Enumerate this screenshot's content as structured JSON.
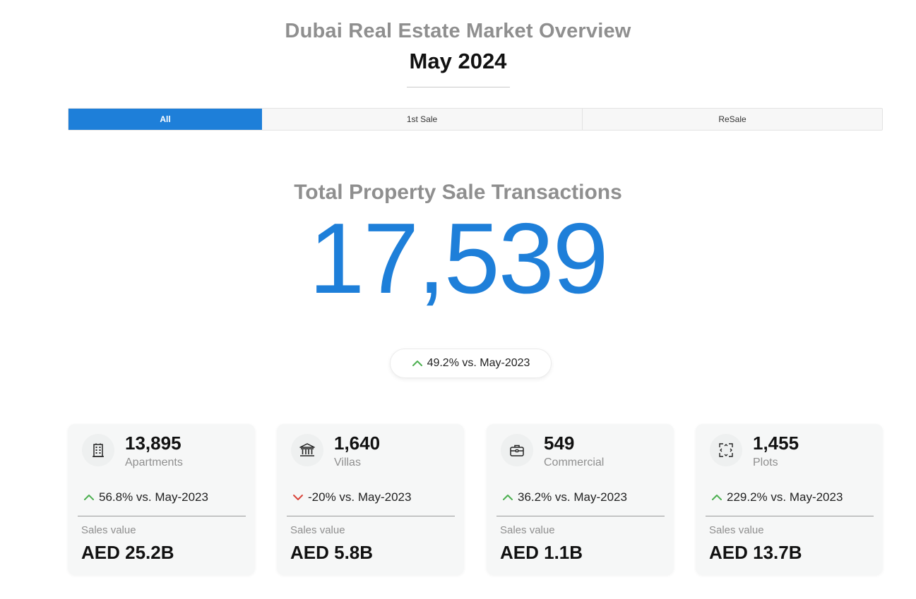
{
  "header": {
    "title": "Dubai Real Estate Market Overview",
    "period": "May 2024"
  },
  "tabs": [
    {
      "label": "All",
      "active": true
    },
    {
      "label": "1st Sale",
      "active": false
    },
    {
      "label": "ReSale",
      "active": false
    }
  ],
  "hero": {
    "label": "Total Property Sale Transactions",
    "value": "17,539",
    "change": "49.2% vs. May-2023",
    "trend": "up"
  },
  "cards": [
    {
      "icon": "apartment-building-icon",
      "count": "13,895",
      "type": "Apartments",
      "change": "56.8% vs. May-2023",
      "trend": "up",
      "sales_value_label": "Sales value",
      "sales_value": "AED 25.2B"
    },
    {
      "icon": "villa-bank-icon",
      "count": "1,640",
      "type": "Villas",
      "change": "-20% vs. May-2023",
      "trend": "down",
      "sales_value_label": "Sales value",
      "sales_value": "AED 5.8B"
    },
    {
      "icon": "briefcase-icon",
      "count": "549",
      "type": "Commercial",
      "change": "36.2% vs. May-2023",
      "trend": "up",
      "sales_value_label": "Sales value",
      "sales_value": "AED 1.1B"
    },
    {
      "icon": "plot-expand-icon",
      "count": "1,455",
      "type": "Plots",
      "change": "229.2% vs. May-2023",
      "trend": "up",
      "sales_value_label": "Sales value",
      "sales_value": "AED 13.7B"
    }
  ],
  "colors": {
    "accent": "#1e7fd9",
    "muted_text": "#8f8f8f",
    "up": "#4caf50",
    "down": "#d9443a",
    "card_bg": "#f6f7f7"
  }
}
